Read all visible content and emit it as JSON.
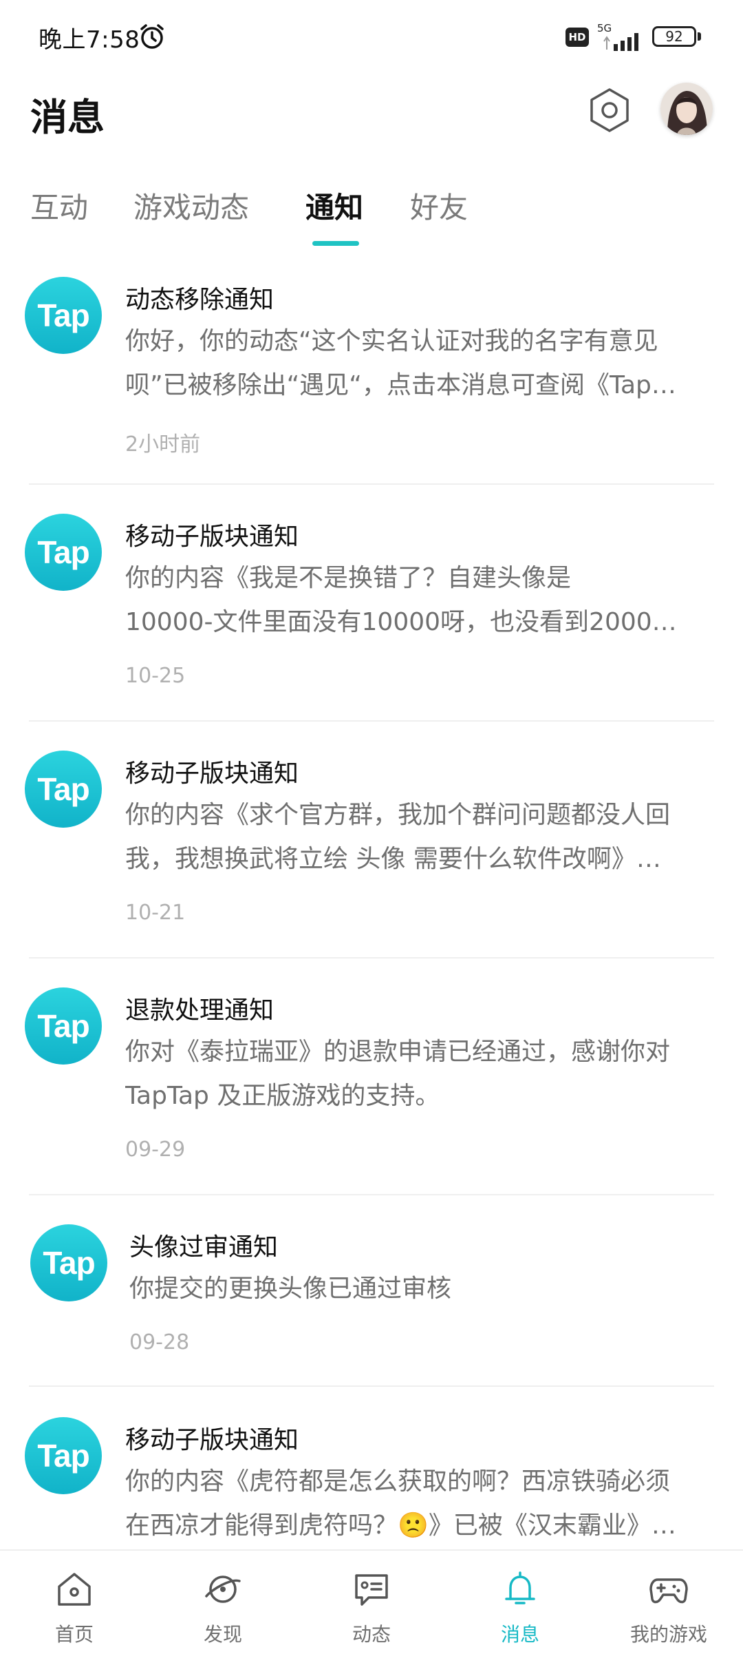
{
  "status_bar": {
    "time": "晚上7:58",
    "network": "5G",
    "hd_label": "HD",
    "battery": "92",
    "battery_level": 0.92
  },
  "header": {
    "title": "消息"
  },
  "tabs": [
    {
      "label": "互动",
      "active": false
    },
    {
      "label": "游戏动态",
      "active": false
    },
    {
      "label": "通知",
      "active": true
    },
    {
      "label": "好友",
      "active": false
    }
  ],
  "logo_text": "Tap",
  "notifications": [
    {
      "title": "动态移除通知",
      "lines": [
        "你好，你的动态“这个实名认证对我的名字有意见",
        "呗”已被移除出“遇见“，点击本消息可查阅《Tap…"
      ],
      "time": "2小时前"
    },
    {
      "title": "移动子版块通知",
      "lines": [
        "你的内容《我是不是换错了？自建头像是",
        "10000-文件里面没有10000呀，也没看到2000…"
      ],
      "time": "10-25"
    },
    {
      "title": "移动子版块通知",
      "lines": [
        "你的内容《求个官方群，我加个群问问题都没人回",
        "我，我想换武将立绘 头像 需要什么软件改啊》…"
      ],
      "time": "10-21"
    },
    {
      "title": "退款处理通知",
      "lines": [
        "你对《泰拉瑞亚》的退款申请已经通过，感谢你对",
        "TapTap 及正版游戏的支持。"
      ],
      "time": "09-29"
    },
    {
      "title": "头像过审通知",
      "lines": [
        "你提交的更换头像已通过审核"
      ],
      "time": "09-28"
    },
    {
      "title": "移动子版块通知",
      "lines": [
        "你的内容《虎符都是怎么获取的啊？西凉铁骑必须",
        "在西凉才能得到虎符吗？🙁》已被《汉末霸业》…"
      ],
      "time": ""
    }
  ],
  "bottom_nav": [
    {
      "label": "首页",
      "icon": "home-icon",
      "active": false
    },
    {
      "label": "发现",
      "icon": "discover-icon",
      "active": false
    },
    {
      "label": "动态",
      "icon": "feed-icon",
      "active": false
    },
    {
      "label": "消息",
      "icon": "bell-icon",
      "active": true
    },
    {
      "label": "我的游戏",
      "icon": "gamepad-icon",
      "active": false
    }
  ],
  "colors": {
    "accent": "#16b9c5",
    "logo": "#1fc3d3"
  }
}
